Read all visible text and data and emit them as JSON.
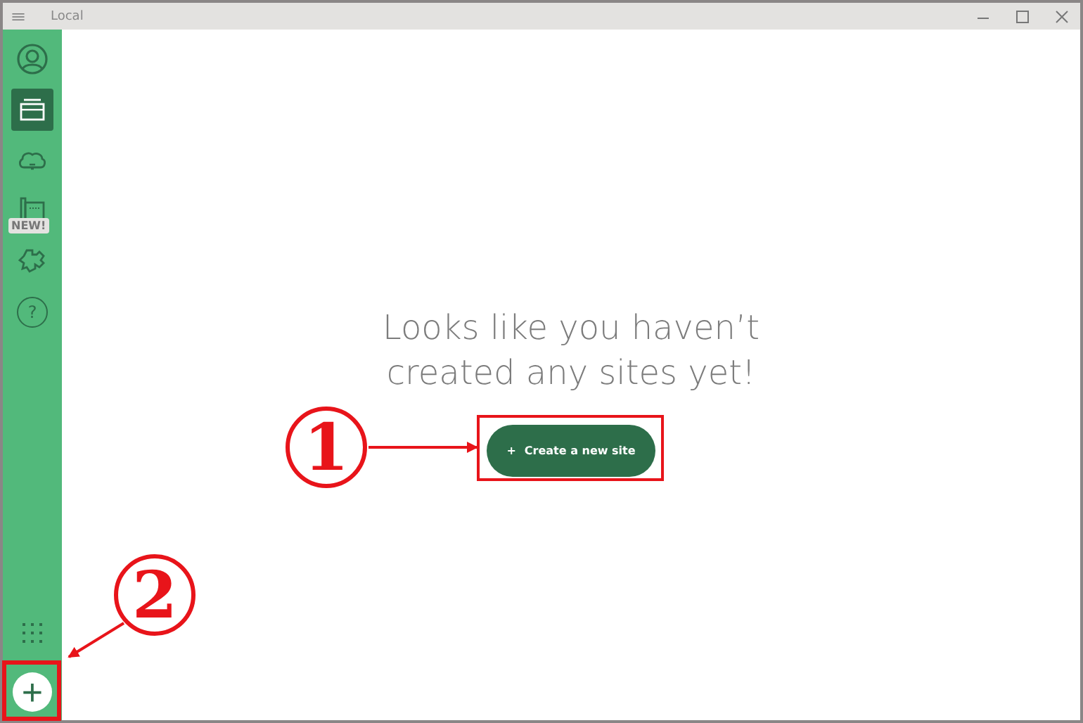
{
  "window": {
    "title": "Local"
  },
  "sidebar": {
    "items": [
      {
        "kind": "user",
        "selected": false
      },
      {
        "kind": "sites",
        "selected": true
      },
      {
        "kind": "cloud",
        "selected": false
      },
      {
        "kind": "blueprint",
        "selected": false,
        "badge": "NEW!"
      },
      {
        "kind": "addons",
        "selected": false
      },
      {
        "kind": "help",
        "selected": false,
        "glyph": "?"
      }
    ]
  },
  "empty_state": {
    "message": "Looks like you haven’t created any sites yet!",
    "button": {
      "icon": "+",
      "label": "Create a new site"
    }
  },
  "annotations": [
    {
      "label": "1"
    },
    {
      "label": "2"
    }
  ]
}
